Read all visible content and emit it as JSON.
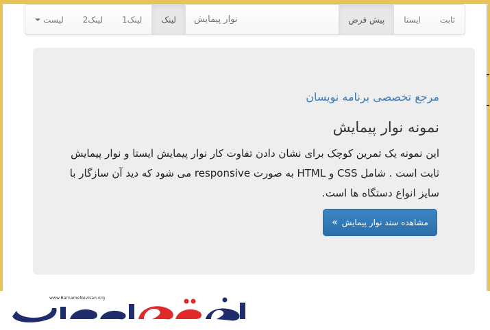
{
  "navbar": {
    "right_items": [
      {
        "label": "ثابت",
        "active": false
      },
      {
        "label": "ایستا",
        "active": false
      },
      {
        "label": "پیش فرض",
        "active": true
      }
    ],
    "left_items": [
      {
        "label": "لیست",
        "active": false,
        "dropdown": true
      },
      {
        "label": "لینک2",
        "active": false
      },
      {
        "label": "لینک1",
        "active": false
      },
      {
        "label": "لینک",
        "active": true
      }
    ],
    "brand": "نوار پیمایش"
  },
  "jumbotron": {
    "subtitle": "مرجع تخصصی برنامه نویسان",
    "title": "نمونه نوار پیمایش",
    "lead": "این نمونه یک تمرین کوچک برای نشان دادن تفاوت کار نوار پیمایش ایستا و نوار پیمایش ثابت است . شامل CSS و HTML به صورت responsive می شود که دید آن سازگار با سایز انواع دستگاه ها است.",
    "button_label": "مشاهده سند نوار پیمایش",
    "button_icon": "»"
  },
  "logo": {
    "url": "www.BarnameNevisan.org",
    "colors": {
      "navy": "#1f2d6b",
      "red": "#e02a2a"
    }
  },
  "colors": {
    "frame": "#e7c35a",
    "primary": "#2f74b2",
    "link": "#3a7ab8",
    "jumbotron_bg": "#eeeeee"
  }
}
